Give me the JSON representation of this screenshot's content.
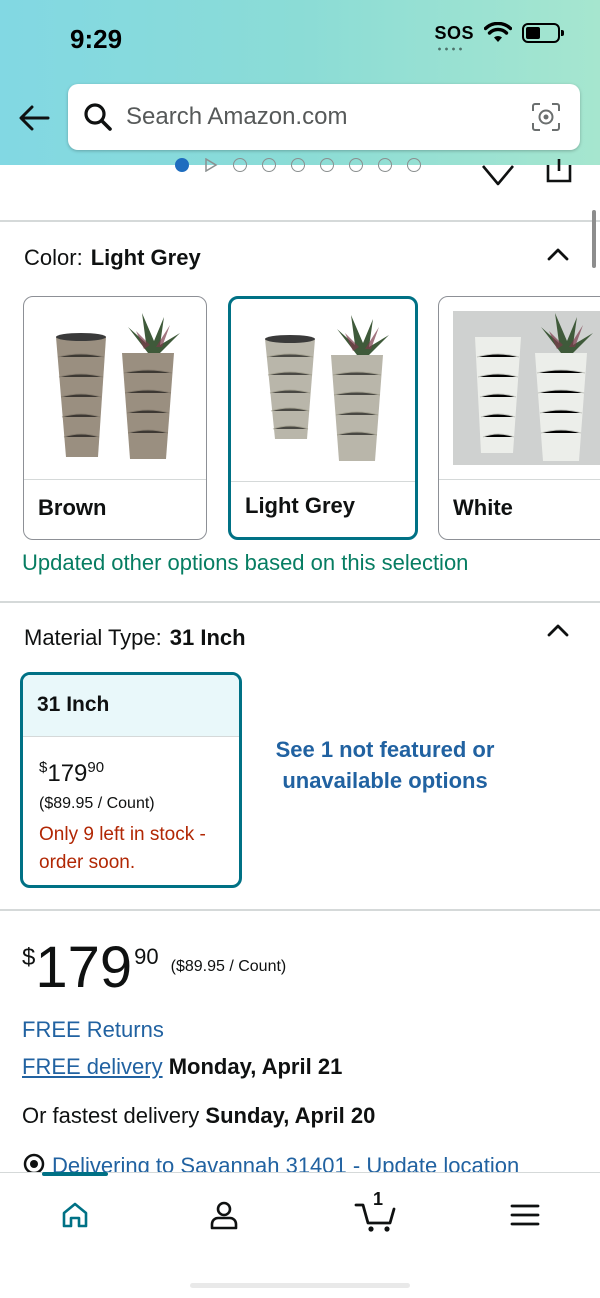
{
  "status": {
    "time": "9:29",
    "sos": "SOS"
  },
  "search": {
    "placeholder": "Search Amazon.com"
  },
  "color": {
    "label": "Color:",
    "selected": "Light Grey",
    "options": [
      {
        "name": "Brown",
        "pot_color": "#9a8f80"
      },
      {
        "name": "Light Grey",
        "pot_color": "#b9b6aa"
      },
      {
        "name": "White",
        "pot_color": "#e6e8e4"
      }
    ],
    "updated_note": "Updated other options based on this selection"
  },
  "material": {
    "label": "Material Type:",
    "selected": "31 Inch",
    "option": {
      "name": "31 Inch",
      "price_symbol": "$",
      "price_whole": "179",
      "price_fraction": "90",
      "unit_price": "($89.95 / Count)",
      "stock": "Only 9 left in stock - order soon."
    },
    "not_featured": "See 1 not featured or unavailable options"
  },
  "price": {
    "symbol": "$",
    "whole": "179",
    "fraction": "90",
    "unit": "($89.95 / Count)"
  },
  "delivery": {
    "free_returns": "FREE Returns",
    "free_delivery_link": "FREE delivery",
    "free_delivery_date": "Monday, April 21",
    "fastest_prefix": "Or fastest delivery",
    "fastest_date": "Sunday, April 20",
    "deliver_to": "Delivering to Savannah 31401 - Update location"
  },
  "nav": {
    "cart_count": "1"
  },
  "colors": {
    "accent": "#007185",
    "link": "#2162a1",
    "success": "#067d62",
    "warning": "#b12704"
  }
}
